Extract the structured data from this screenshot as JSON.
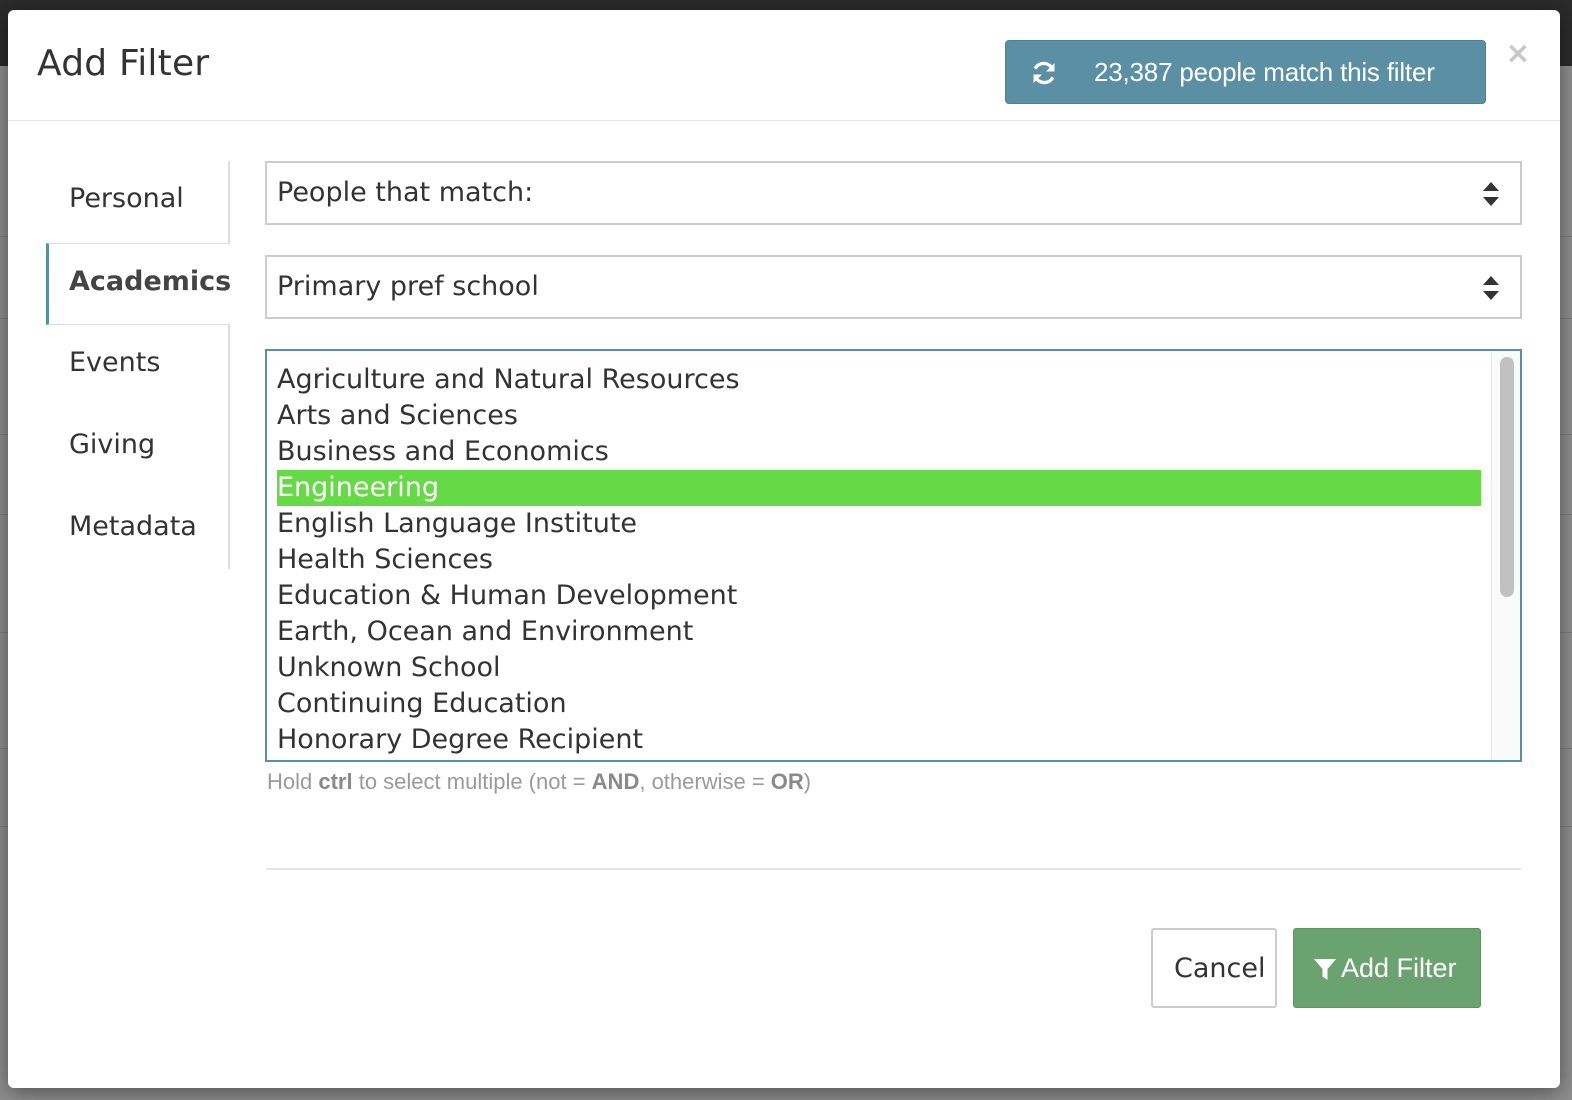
{
  "dialog": {
    "title": "Add Filter",
    "match_count_label": "23,387 people match this filter",
    "close_glyph": "×"
  },
  "sidebar": {
    "items": [
      {
        "label": "Personal",
        "active": false
      },
      {
        "label": "Academics",
        "active": true
      },
      {
        "label": "Events",
        "active": false
      },
      {
        "label": "Giving",
        "active": false
      },
      {
        "label": "Metadata",
        "active": false
      }
    ]
  },
  "form": {
    "match_select": {
      "value": "People that match:"
    },
    "field_select": {
      "value": "Primary pref school"
    },
    "options": [
      {
        "label": "Agriculture and Natural Resources",
        "selected": false
      },
      {
        "label": "Arts and Sciences",
        "selected": false
      },
      {
        "label": "Business and Economics",
        "selected": false
      },
      {
        "label": "Engineering",
        "selected": true
      },
      {
        "label": "English Language Institute",
        "selected": false
      },
      {
        "label": "Health Sciences",
        "selected": false
      },
      {
        "label": "Education & Human Development",
        "selected": false
      },
      {
        "label": "Earth, Ocean and Environment",
        "selected": false
      },
      {
        "label": "Unknown School",
        "selected": false
      },
      {
        "label": "Continuing Education",
        "selected": false
      },
      {
        "label": "Honorary Degree Recipient",
        "selected": false
      }
    ],
    "help": {
      "p1": "Hold ",
      "ctrl": "ctrl",
      "p2": " to select multiple (not = ",
      "and": "AND",
      "p3": ", otherwise = ",
      "or": "OR",
      "p4": ")"
    }
  },
  "footer": {
    "cancel_label": "Cancel",
    "add_label": "Add Filter"
  },
  "colors": {
    "accent": "#5b8fa3",
    "selected_option": "#66d947",
    "add_button": "#6aa36f"
  },
  "icons": {
    "match_button": "refresh-icon",
    "select_arrows": "sort-icon",
    "add_button": "filter-icon",
    "close": "close-icon"
  }
}
